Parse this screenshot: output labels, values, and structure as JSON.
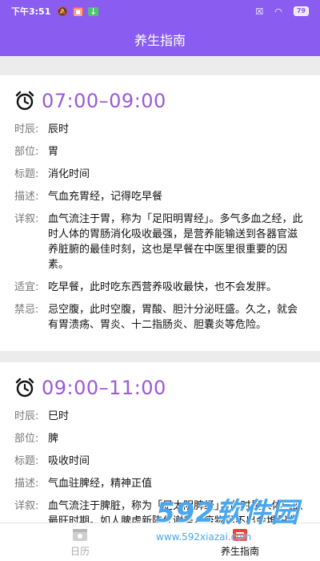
{
  "status_bar": {
    "time": "下午3:51",
    "battery": "79"
  },
  "header": {
    "title": "养生指南"
  },
  "entries": [
    {
      "time_range": "07:00–09:00",
      "rows": [
        {
          "label": "时辰:",
          "value": "辰时"
        },
        {
          "label": "部位:",
          "value": "胃"
        },
        {
          "label": "标题:",
          "value": "消化时间"
        },
        {
          "label": "描述:",
          "value": "气血充胃经，记得吃早餐"
        },
        {
          "label": "详叙:",
          "value": "血气流注于胃，称为「足阳明胃经」。多气多血之经，此时人体的胃肠消化吸收最强，是营养能输送到各器官滋养脏腑的最佳时刻，这也是早餐在中医里很重要的因素。"
        },
        {
          "label": "适宜:",
          "value": "吃早餐，此时吃东西营养吸收最快，也不会发胖。"
        },
        {
          "label": "禁忌:",
          "value": "忌空腹，此时空腹，胃酸、胆汁分泌旺盛。久之，就会有胃溃疡、胃炎、十二指肠炎、胆囊炎等危险。"
        }
      ]
    },
    {
      "time_range": "09:00–11:00",
      "rows": [
        {
          "label": "时辰:",
          "value": "巳时"
        },
        {
          "label": "部位:",
          "value": "脾"
        },
        {
          "label": "标题:",
          "value": "吸收时间"
        },
        {
          "label": "描述:",
          "value": "气血驻脾经，精神正值"
        },
        {
          "label": "详叙:",
          "value": "血气流注于脾脏，称为「足太阴脾经」，此时是人体气血最旺时期。如人脾虚新陈代谢差，废物运不出会堆积在心包里"
        }
      ]
    }
  ],
  "tabs": [
    {
      "label": "日历",
      "icon": "calendar-icon",
      "active": false
    },
    {
      "label": "养生指南",
      "icon": "guide-icon",
      "active": true
    }
  ],
  "watermark": {
    "brand": "592软件园",
    "url": "www.592xiazai.com"
  },
  "colors": {
    "primary": "#8a5df0",
    "time_text": "#9b59d6",
    "watermark": "#4aa7ee"
  }
}
